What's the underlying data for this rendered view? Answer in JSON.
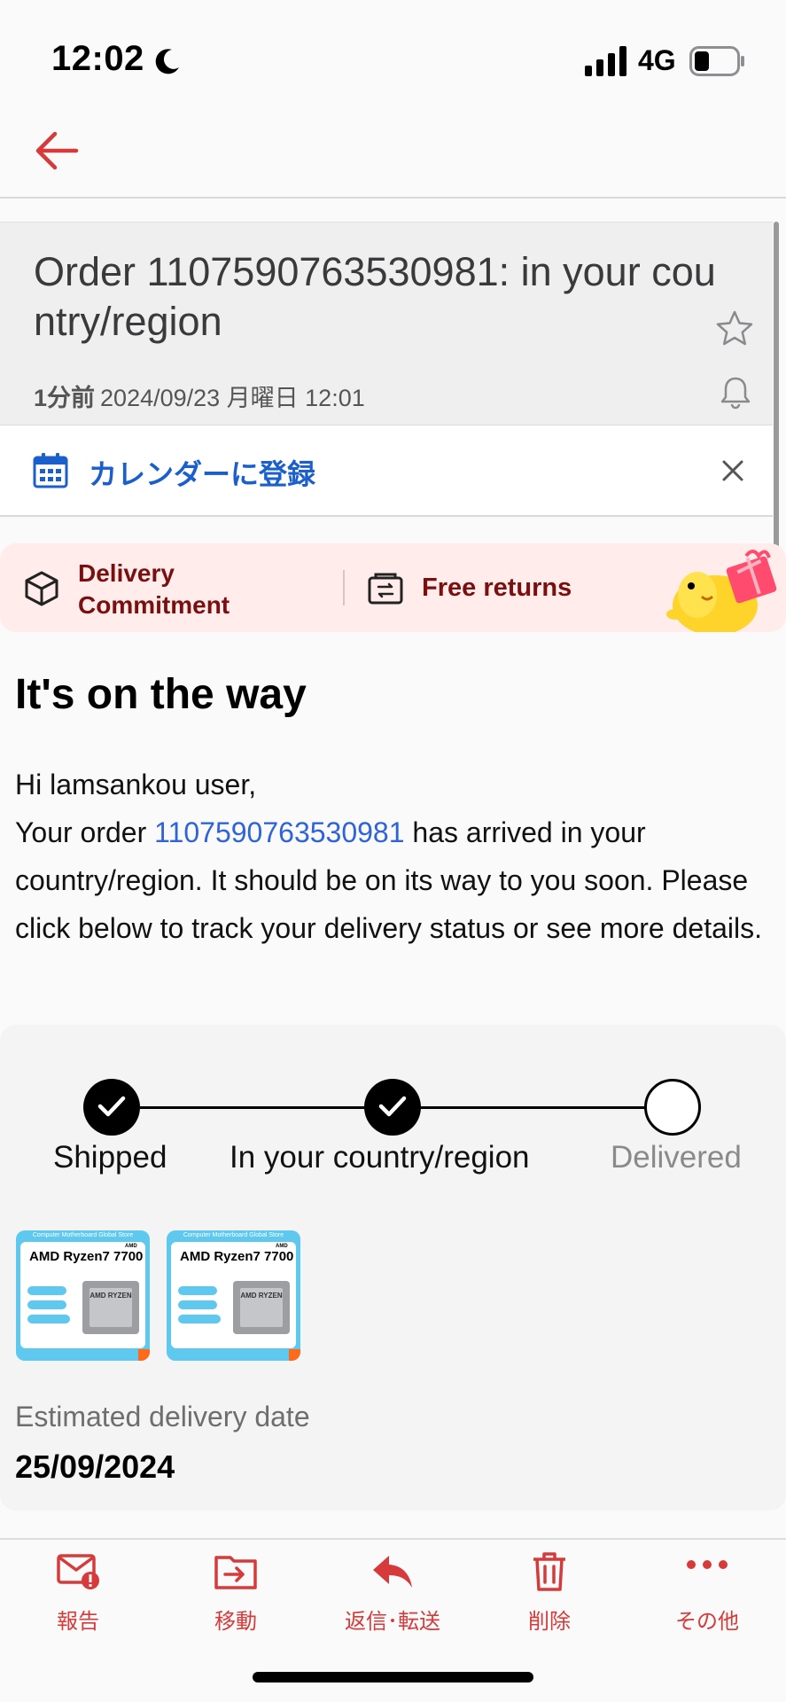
{
  "status_bar": {
    "time": "12:02",
    "network": "4G"
  },
  "mail": {
    "subject": "Order 1107590763530981: in your country/region",
    "ago": "1分前",
    "datetime": "2024/09/23 月曜日 12:01"
  },
  "calendar_bar": {
    "label": "カレンダーに登録"
  },
  "promo": {
    "commitment": "Delivery Commitment",
    "returns": "Free returns"
  },
  "body": {
    "headline": "It's on the way",
    "greeting": "Hi lamsankou user,",
    "order_prefix": "Your order ",
    "order_number": "1107590763530981",
    "order_suffix": " has arrived in your country/region. It should be on its way to you soon. Please click below to track your delivery status or see more details."
  },
  "tracking": {
    "steps": [
      {
        "label": "Shipped",
        "done": true
      },
      {
        "label": "In your country/region",
        "done": true
      },
      {
        "label": "Delivered",
        "done": false
      }
    ],
    "products": [
      {
        "store": "Computer Motherboard Global Store",
        "title": "AMD Ryzen7 7700",
        "brand": "AMD",
        "chip": "AMD RYZEN"
      },
      {
        "store": "Computer Motherboard Global Store",
        "title": "AMD Ryzen7 7700",
        "brand": "AMD",
        "chip": "AMD RYZEN"
      }
    ],
    "estimated_label": "Estimated delivery date",
    "estimated_date": "25/09/2024"
  },
  "toolbar": {
    "report": "報告",
    "move": "移動",
    "reply": "返信･転送",
    "delete": "削除",
    "more": "その他"
  },
  "colors": {
    "accent": "#d63a3a",
    "link": "#2f63d8",
    "promo_text": "#7a0f0f",
    "promo_bg": "#ffeceb"
  }
}
